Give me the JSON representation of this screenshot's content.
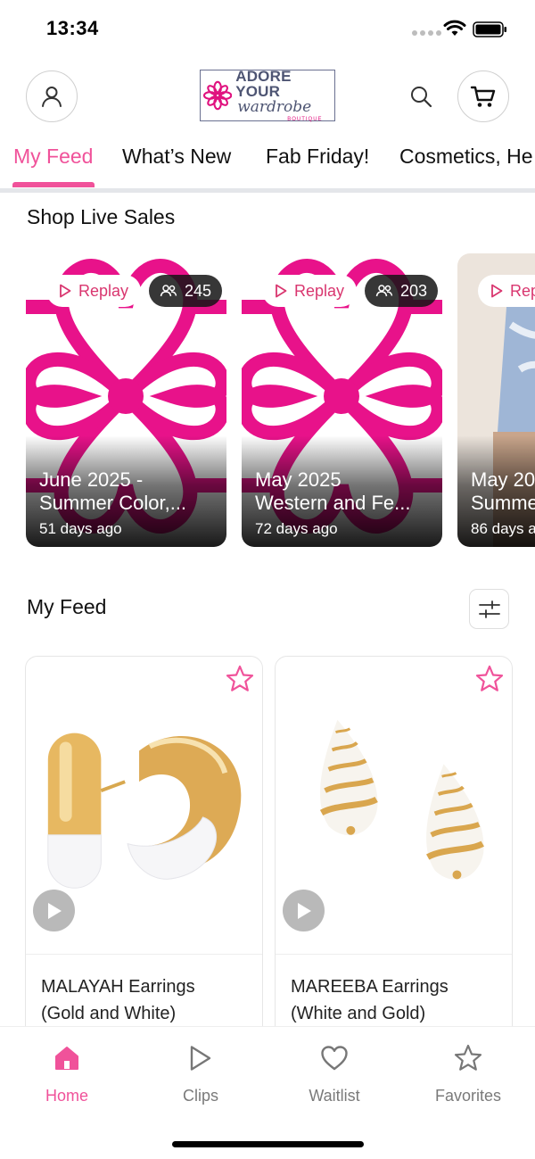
{
  "status_bar": {
    "time": "13:34"
  },
  "header": {
    "logo": {
      "line1": "ADORE YOUR",
      "line2": "wardrobe",
      "line3": "BOUTIQUE"
    },
    "icons": [
      "person-icon",
      "search-icon",
      "cart-icon"
    ]
  },
  "tabs": [
    {
      "label": "My Feed",
      "active": true
    },
    {
      "label": "What’s New",
      "active": false
    },
    {
      "label": "Fab Friday!",
      "active": false
    },
    {
      "label": "Cosmetics, He",
      "active": false
    }
  ],
  "live_sales": {
    "title": "Shop Live Sales",
    "cards": [
      {
        "replay": "Replay",
        "viewers": "245",
        "title_line1": "June 2025 -",
        "title_line2": "Summer Color,...",
        "ago": "51 days ago"
      },
      {
        "replay": "Replay",
        "viewers": "203",
        "title_line1": "May 2025",
        "title_line2": "Western and Fe...",
        "ago": "72 days ago"
      },
      {
        "replay": "Rep",
        "viewers": "",
        "title_line1": "May 20",
        "title_line2": "Summe",
        "ago": "86 days a"
      }
    ]
  },
  "feed": {
    "title": "My Feed",
    "products": [
      {
        "name_line1": "MALAYAH Earrings",
        "name_line2": "(Gold and White)"
      },
      {
        "name_line1": "MAREEBA Earrings",
        "name_line2": "(White and Gold)"
      }
    ]
  },
  "bottom_nav": [
    {
      "label": "Home",
      "icon": "home-icon",
      "active": true
    },
    {
      "label": "Clips",
      "icon": "play-icon",
      "active": false
    },
    {
      "label": "Waitlist",
      "icon": "heart-icon",
      "active": false
    },
    {
      "label": "Favorites",
      "icon": "star-icon",
      "active": false
    }
  ],
  "colors": {
    "accent": "#f0529a",
    "brand_pink": "#e0127f",
    "logo_navy": "#4e5573"
  }
}
